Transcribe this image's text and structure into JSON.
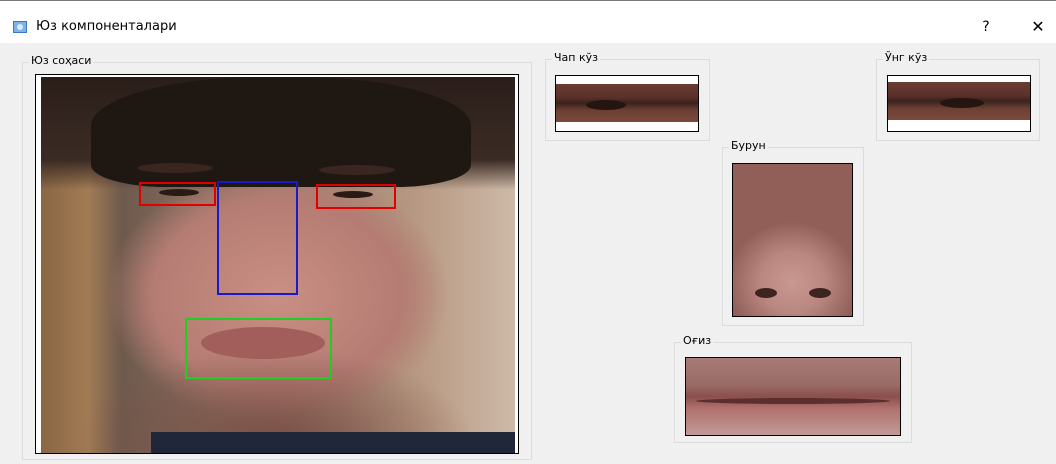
{
  "window": {
    "title": "Юз компоненталари",
    "help_label": "?",
    "close_label": "✕",
    "icon": "app-window-icon"
  },
  "groups": {
    "face_area": "Юз соҳаси",
    "left_eye": "Чап кўз",
    "right_eye": "Ўнг кўз",
    "nose": "Бурун",
    "mouth": "Оғиз"
  },
  "colors": {
    "eye_box": "#e00000",
    "nose_box": "#1a1ac8",
    "mouth_box": "#22cc22"
  }
}
